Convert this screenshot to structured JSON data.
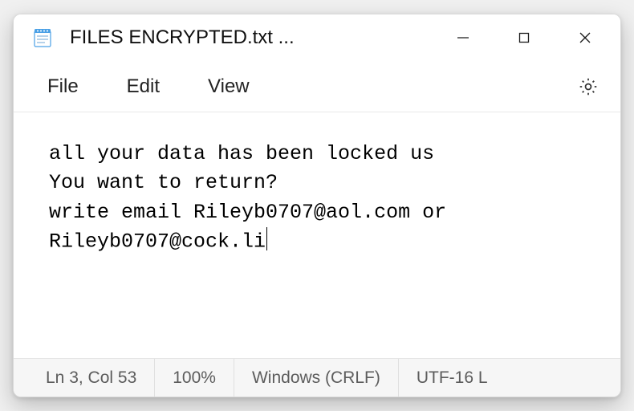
{
  "window": {
    "title": "FILES ENCRYPTED.txt ..."
  },
  "menu": {
    "file": "File",
    "edit": "Edit",
    "view": "View"
  },
  "content": {
    "text": "all your data has been locked us\nYou want to return?\nwrite email Rileyb0707@aol.com or Rileyb0707@cock.li"
  },
  "status": {
    "cursor": "Ln 3, Col 53",
    "zoom": "100%",
    "line_ending": "Windows (CRLF)",
    "encoding": "UTF-16 L"
  },
  "icons": {
    "app": "notepad-icon",
    "minimize": "minimize-icon",
    "maximize": "maximize-icon",
    "close": "close-icon",
    "settings": "gear-icon"
  }
}
